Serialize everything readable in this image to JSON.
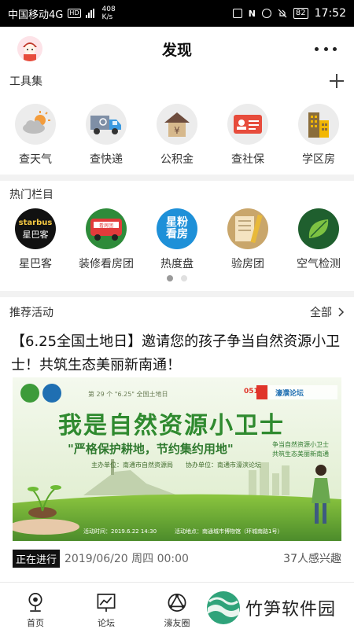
{
  "status_bar": {
    "carrier": "中国移动4G",
    "hd": "HD",
    "speed_value": "408",
    "speed_unit": "K/s",
    "battery": "82",
    "time": "17:52"
  },
  "header": {
    "title": "发现"
  },
  "tools": {
    "title": "工具集",
    "items": [
      {
        "label": "查天气",
        "icon": "weather-icon"
      },
      {
        "label": "查快递",
        "icon": "delivery-truck-icon"
      },
      {
        "label": "公积金",
        "icon": "housing-fund-icon"
      },
      {
        "label": "查社保",
        "icon": "social-security-card-icon"
      },
      {
        "label": "学区房",
        "icon": "school-district-building-icon"
      }
    ]
  },
  "hot": {
    "title": "热门栏目",
    "items": [
      {
        "label": "星巴客",
        "icon": "starbus-logo-icon",
        "logo_text_1": "starbus",
        "logo_text_2": "星巴客"
      },
      {
        "label": "装修看房团",
        "icon": "bus-tour-icon",
        "logo_text_1": "看房团"
      },
      {
        "label": "热度盘",
        "icon": "hot-property-icon",
        "logo_text_1": "星粉",
        "logo_text_2": "看房"
      },
      {
        "label": "验房团",
        "icon": "inspection-tools-icon"
      },
      {
        "label": "空气检测",
        "icon": "air-leaf-icon"
      }
    ],
    "page_count": 2,
    "active_page": 1
  },
  "activity": {
    "section_title": "推荐活动",
    "see_all": "全部",
    "title": "【6.25全国土地日】邀请您的孩子争当自然资源小卫士！共筑生态美丽新南通！",
    "banner": {
      "top_line": "第 29 个 \"6.25\" 全国土地日",
      "logo_text": "濠濮论坛",
      "logo_num": "0513",
      "headline": "我是自然资源小卫士",
      "slogan": "\"严格保护耕地，节约集约用地\"",
      "side_1": "争当自然资源小卫士",
      "side_2": "共筑生态美丽新南通",
      "host": "主办单位：南通市自然资源局",
      "co_host": "协办单位：南通市濠滨论坛",
      "time_info": "活动时间：2019.6.22 14:30",
      "place_info": "活动地点：南通城市博物馆（环城南路1号）"
    },
    "status": "正在进行",
    "date": "2019/06/20 周四 00:00",
    "interest": "37人感兴趣"
  },
  "bottom_nav": [
    {
      "label": "首页",
      "icon": "home-camera-icon"
    },
    {
      "label": "论坛",
      "icon": "forum-chart-icon"
    },
    {
      "label": "濠友圈",
      "icon": "friend-circle-icon"
    }
  ],
  "watermark": "竹笋软件园",
  "colors": {
    "accent_green": "#3d9b3a",
    "badge": "#111111"
  }
}
